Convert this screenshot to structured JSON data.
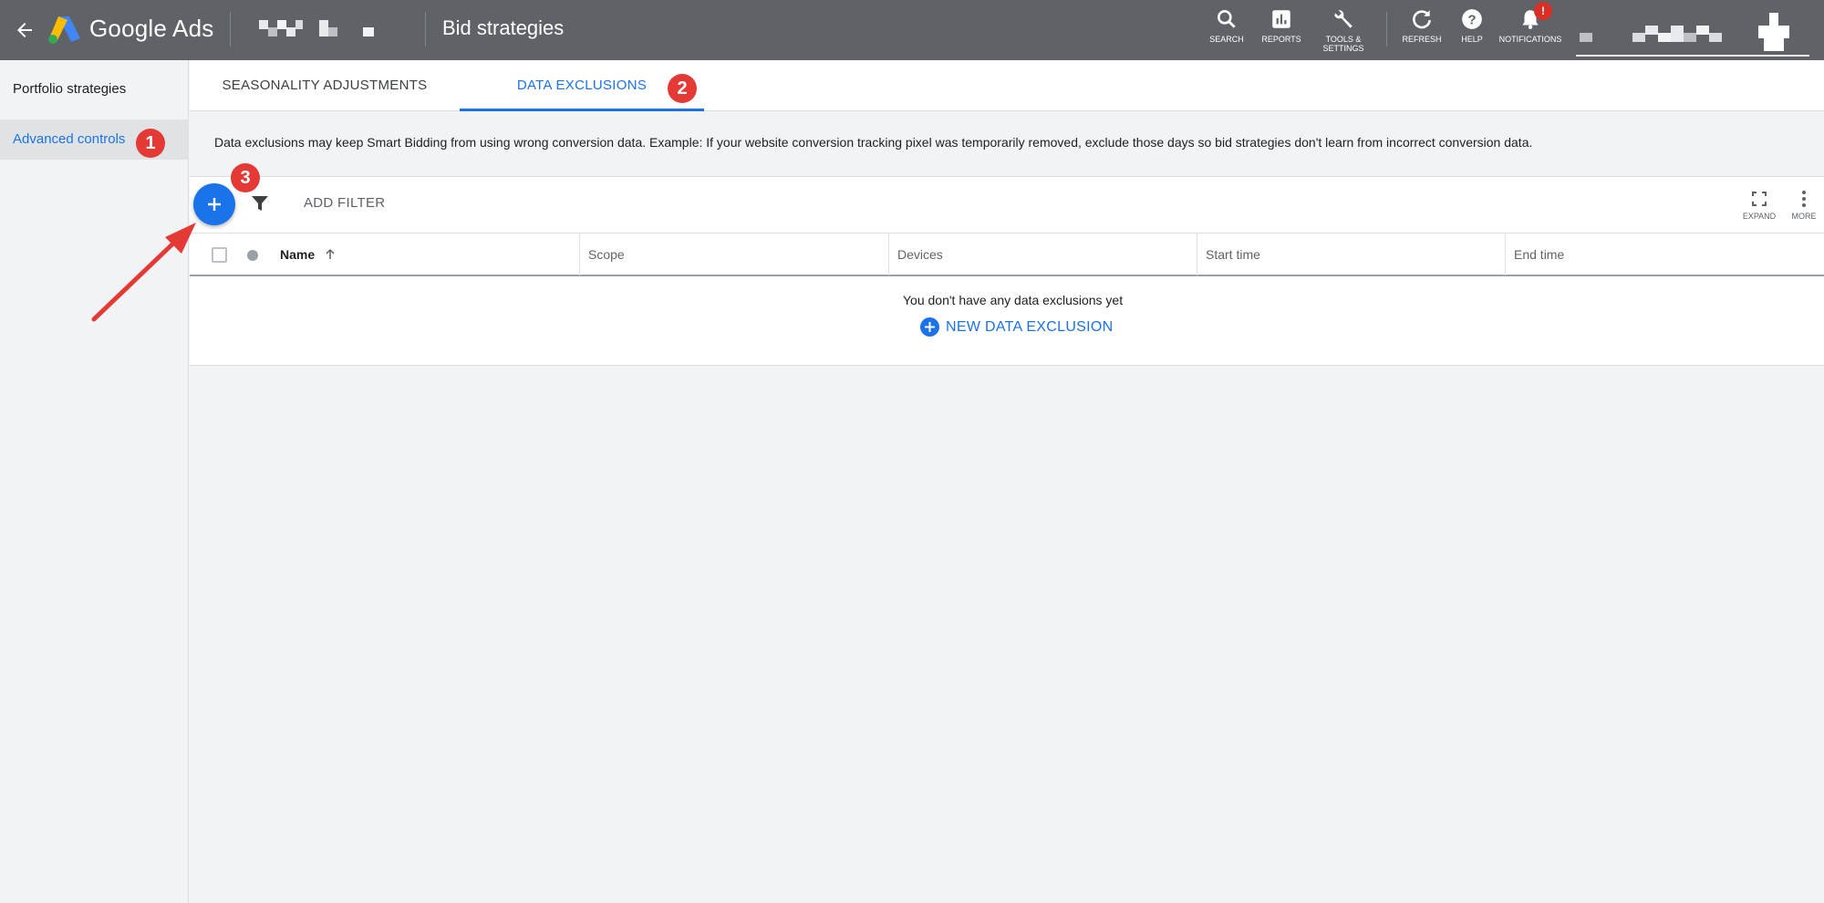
{
  "header": {
    "brand": "Google Ads",
    "page_title": "Bid strategies",
    "toolbar": [
      {
        "label": "SEARCH",
        "icon": "search-icon"
      },
      {
        "label": "REPORTS",
        "icon": "reports-icon"
      },
      {
        "label": "TOOLS & SETTINGS",
        "icon": "wrench-icon"
      },
      {
        "label": "REFRESH",
        "icon": "refresh-icon"
      },
      {
        "label": "HELP",
        "icon": "help-icon"
      },
      {
        "label": "NOTIFICATIONS",
        "icon": "bell-icon",
        "badge": "!"
      }
    ]
  },
  "sidebar": {
    "items": [
      {
        "label": "Portfolio strategies",
        "active": false
      },
      {
        "label": "Advanced controls",
        "active": true
      }
    ]
  },
  "tabs": [
    {
      "label": "SEASONALITY ADJUSTMENTS",
      "active": false
    },
    {
      "label": "DATA EXCLUSIONS",
      "active": true
    }
  ],
  "info_text": "Data exclusions may keep Smart Bidding from using wrong conversion data. Example: If your website conversion tracking pixel was temporarily removed, exclude those days so bid strategies don't learn from incorrect conversion data.",
  "table": {
    "add_filter": "ADD FILTER",
    "expand_label": "EXPAND",
    "more_label": "MORE",
    "columns": [
      "Name",
      "Scope",
      "Devices",
      "Start time",
      "End time"
    ],
    "empty_message": "You don't have any data exclusions yet",
    "new_button": "NEW DATA EXCLUSION"
  },
  "annotations": [
    "1",
    "2",
    "3"
  ],
  "colors": {
    "topbar": "#5f6368",
    "accent": "#1a73e8",
    "annotation": "#e53935"
  }
}
